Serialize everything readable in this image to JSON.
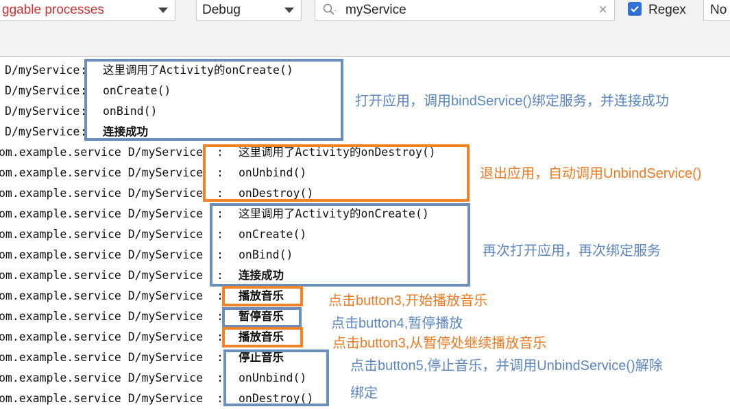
{
  "toolbar": {
    "process_filter": "ggable processes",
    "log_level": "Debug",
    "search_value": "myService",
    "regex_checked": true,
    "regex_label": "Regex",
    "filter_config": "No"
  },
  "log_lines": [
    {
      "prefix": "D/myService",
      "message": "这里调用了Activity的onCreate()"
    },
    {
      "prefix": "D/myService",
      "message": "onCreate()"
    },
    {
      "prefix": "D/myService",
      "message": "onBind()"
    },
    {
      "prefix": "D/myService",
      "message": "连接成功"
    },
    {
      "prefix": "om.example.service D/myService",
      "message": "这里调用了Activity的onDestroy()"
    },
    {
      "prefix": "om.example.service D/myService",
      "message": "onUnbind()"
    },
    {
      "prefix": "om.example.service D/myService",
      "message": "onDestroy()"
    },
    {
      "prefix": "om.example.service D/myService",
      "message": "这里调用了Activity的onCreate()"
    },
    {
      "prefix": "om.example.service D/myService",
      "message": "onCreate()"
    },
    {
      "prefix": "om.example.service D/myService",
      "message": "onBind()"
    },
    {
      "prefix": "om.example.service D/myService",
      "message": "连接成功"
    },
    {
      "prefix": "om.example.service D/myService",
      "message": "播放音乐"
    },
    {
      "prefix": "om.example.service D/myService",
      "message": "暂停音乐"
    },
    {
      "prefix": "om.example.service D/myService",
      "message": "播放音乐"
    },
    {
      "prefix": "om.example.service D/myService",
      "message": "停止音乐"
    },
    {
      "prefix": "om.example.service D/myService",
      "message": "onUnbind()"
    },
    {
      "prefix": "om.example.service D/myService",
      "message": "onDestroy()"
    }
  ],
  "annotations": [
    {
      "text": "打开应用，调用bindService()绑定服务，并连接成功",
      "color": "#5b86c0"
    },
    {
      "text": "退出应用，自动调用UnbindService()",
      "color": "#f07820"
    },
    {
      "text": "再次打开应用，再次绑定服务",
      "color": "#5b86c0"
    },
    {
      "text": "点击button3,开始播放音乐",
      "color": "#f07820"
    },
    {
      "text": "点击button4,暂停播放",
      "color": "#5b86c0"
    },
    {
      "text": "点击button3,从暂停处继续播放音乐",
      "color": "#f07820"
    },
    {
      "text": "点击button5,停止音乐，并调用UnbindService()解除",
      "color": "#5b86c0"
    },
    {
      "text": "绑定",
      "color": "#5b86c0"
    }
  ]
}
